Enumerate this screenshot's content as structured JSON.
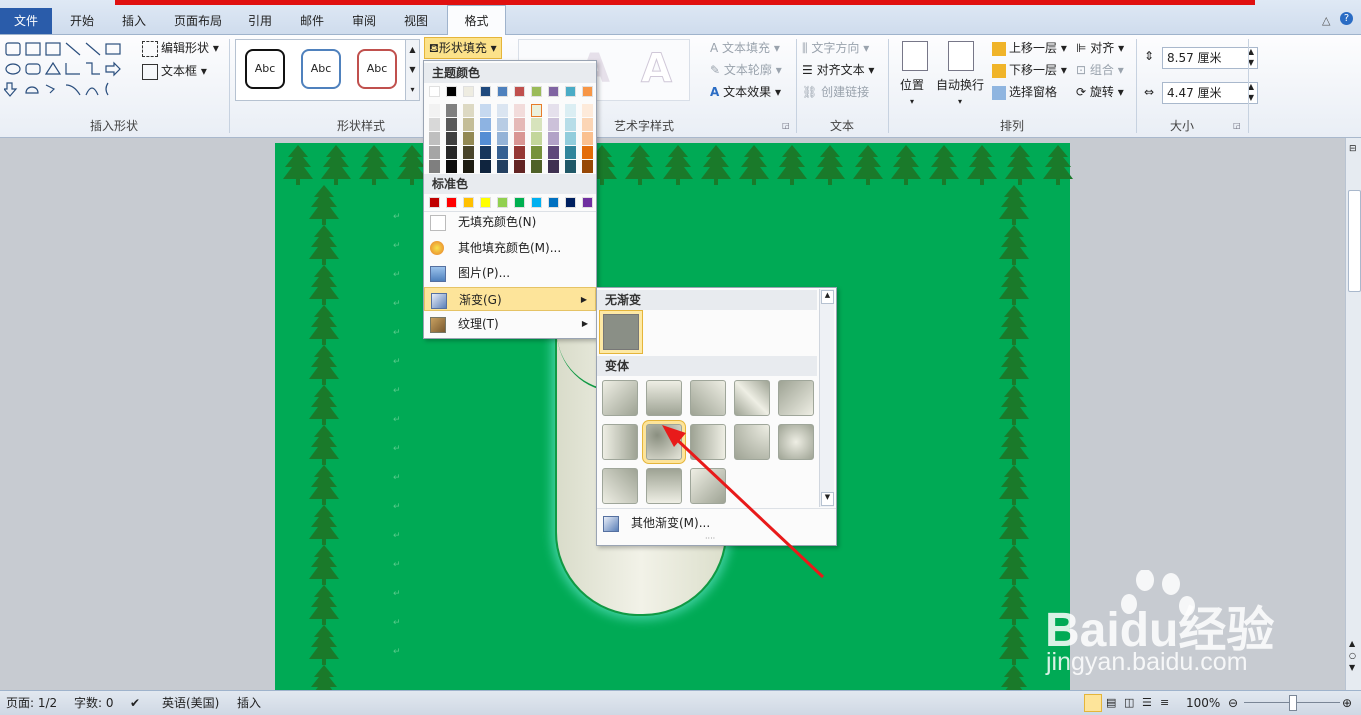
{
  "tabs": [
    "文件",
    "开始",
    "插入",
    "页面布局",
    "引用",
    "邮件",
    "审阅",
    "视图",
    "格式"
  ],
  "ribbon": {
    "insert_shapes": {
      "label": "插入形状",
      "edit_shape": "编辑形状",
      "text_box": "文本框"
    },
    "shape_styles": {
      "label": "形状样式",
      "style_samples": [
        "Abc",
        "Abc",
        "Abc"
      ],
      "fill_button": "形状填充"
    },
    "wordart": {
      "label": "艺术字样式",
      "text_fill": "文本填充",
      "text_outline": "文本轮廓",
      "text_effects": "文本效果"
    },
    "text": {
      "label": "文本",
      "text_direction": "文字方向",
      "align_text": "对齐文本",
      "create_link": "创建链接"
    },
    "arrange": {
      "label": "排列",
      "position": "位置",
      "wrap_text": "自动换行",
      "bring_forward": "上移一层",
      "send_backward": "下移一层",
      "selection_pane": "选择窗格",
      "align": "对齐",
      "group": "组合",
      "rotate": "旋转"
    },
    "size": {
      "label": "大小",
      "height": "8.57 厘米",
      "width": "4.47 厘米"
    }
  },
  "fill_menu": {
    "theme_colors_header": "主题颜色",
    "standard_colors_header": "标准色",
    "no_fill": "无填充颜色(N)",
    "more_colors": "其他填充颜色(M)...",
    "picture": "图片(P)...",
    "gradient": "渐变(G)",
    "texture": "纹理(T)",
    "theme_top": [
      "#ffffff",
      "#000000",
      "#eeece1",
      "#1f497d",
      "#4f81bd",
      "#c0504d",
      "#9bbb59",
      "#8064a2",
      "#4bacc6",
      "#f79646"
    ],
    "standard": [
      "#c00000",
      "#ff0000",
      "#ffc000",
      "#ffff00",
      "#92d050",
      "#00b050",
      "#00b0f0",
      "#0070c0",
      "#002060",
      "#7030a0"
    ]
  },
  "gradient_menu": {
    "no_gradient_header": "无渐变",
    "variants_header": "变体",
    "more_gradients": "其他渐变(M)..."
  },
  "status": {
    "page": "页面: 1/2",
    "words": "字数: 0",
    "language": "英语(美国)",
    "mode": "插入",
    "zoom": "100%"
  },
  "watermark": {
    "brand": "Baidu经验",
    "url": "jingyan.baidu.com"
  }
}
